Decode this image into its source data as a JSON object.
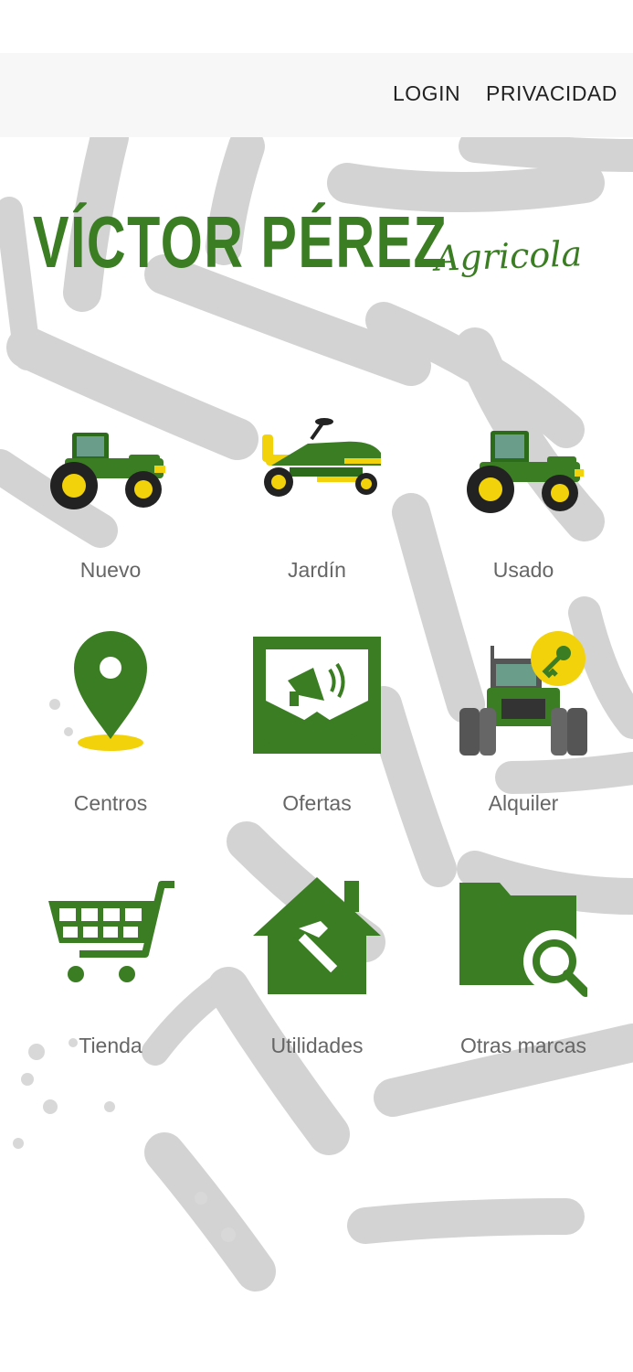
{
  "header": {
    "login_label": "LOGIN",
    "privacy_label": "PRIVACIDAD"
  },
  "brand": {
    "name": "VÍCTOR PÉREZ",
    "subtitle": "Agricola",
    "color": "#3b7d23"
  },
  "menu": {
    "items": [
      {
        "label": "Nuevo",
        "icon": "tractor-icon"
      },
      {
        "label": "Jardín",
        "icon": "lawn-mower-icon"
      },
      {
        "label": "Usado",
        "icon": "tractor-icon"
      },
      {
        "label": "Centros",
        "icon": "location-pin-icon"
      },
      {
        "label": "Ofertas",
        "icon": "megaphone-envelope-icon"
      },
      {
        "label": "Alquiler",
        "icon": "tractor-key-icon"
      },
      {
        "label": "Tienda",
        "icon": "shopping-cart-icon"
      },
      {
        "label": "Utilidades",
        "icon": "house-hammer-icon"
      },
      {
        "label": "Otras marcas",
        "icon": "folder-search-icon"
      }
    ]
  },
  "colors": {
    "green": "#3b7d23",
    "yellow": "#f2d20a",
    "label_gray": "#666666",
    "topbar_bg": "#f7f7f7"
  }
}
